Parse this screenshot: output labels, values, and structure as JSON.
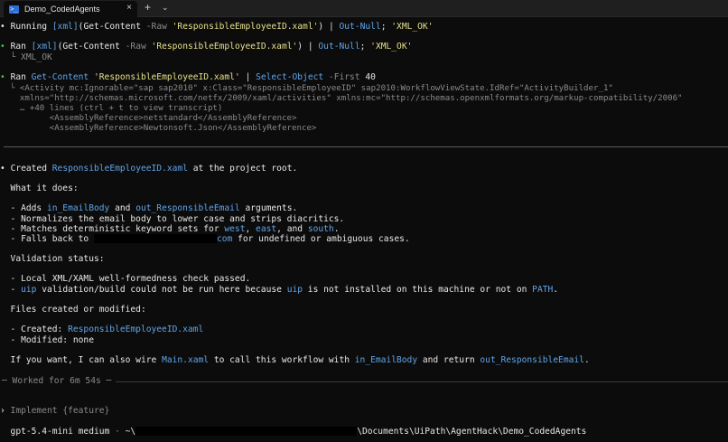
{
  "window": {
    "tab_title": "Demo_CodedAgents",
    "tab_icon": "powershell-icon",
    "close_glyph": "×",
    "new_tab_glyph": "+",
    "dropdown_glyph": "⌄"
  },
  "commands": {
    "running": {
      "bullet": "•",
      "prefix": "Running ",
      "cast": "[xml]",
      "part1": "(Get-Content ",
      "param": "-Raw",
      "sp": " ",
      "file": "'ResponsibleEmployeeID.xaml'",
      "part2": ") | ",
      "outnull": "Out-Null",
      "part3": "; ",
      "ok": "'XML_OK'"
    },
    "ran1": {
      "bullet": "•",
      "prefix": "Ran ",
      "cast": "[xml]",
      "part1": "(Get-Content ",
      "param": "-Raw",
      "sp": " ",
      "file": "'ResponsibleEmployeeID.xaml'",
      "part2": ") | ",
      "outnull": "Out-Null",
      "part3": "; ",
      "ok": "'XML_OK'",
      "output": "  └ XML_OK"
    },
    "ran2": {
      "bullet": "•",
      "prefix": "Ran ",
      "cmd1": "Get-Content",
      "sp": " ",
      "file": "'ResponsibleEmployeeID.xaml'",
      "pipe": " | ",
      "cmd2": "Select-Object",
      "param": " -First ",
      "num": "40",
      "out1": "  └ <Activity mc:Ignorable=\"sap sap2010\" x:Class=\"ResponsibleEmployeeID\" sap2010:WorkflowViewState.IdRef=\"ActivityBuilder_1\"",
      "out2": "    xmlns=\"http://schemas.microsoft.com/netfx/2009/xaml/activities\" xmlns:mc=\"http://schemas.openxmlformats.org/markup-compatibility/2006\"",
      "out3": "    … +40 lines (ctrl + t to view transcript)",
      "out4": "          <AssemblyReference>netstandard</AssemblyReference>",
      "out5": "          <AssemblyReference>Newtonsoft.Json</AssemblyReference>"
    }
  },
  "response": {
    "bullet": "•",
    "created_prefix": "Created ",
    "created_file": "ResponsibleEmployeeID.xaml",
    "created_suffix": " at the project root.",
    "what_heading": "  What it does:",
    "adds_prefix": "  - Adds ",
    "adds_a": "in_EmailBody",
    "adds_mid": " and ",
    "adds_b": "out_ResponsibleEmail",
    "adds_suffix": " arguments.",
    "normalize": "  - Normalizes the email body to lower case and strips diacritics.",
    "matches_prefix": "  - Matches deterministic keyword sets for ",
    "west": "west",
    "comma": ", ",
    "east": "east",
    "and": ", and ",
    "south": "south",
    "period": ".",
    "falls_prefix": "  - Falls back to ",
    "falls_domain": "com",
    "falls_suffix": " for undefined or ambiguous cases.",
    "validation_heading": "  Validation status:",
    "local_check": "  - Local XML/XAML well-formedness check passed.",
    "uip_dash": "  - ",
    "uip1": "uip",
    "uip_mid1": " validation/build could not be run here because ",
    "uip2": "uip",
    "uip_mid2": " is not installed on this machine or not on ",
    "path": "PATH",
    "files_heading": "  Files created or modified:",
    "files_created_prefix": "  - Created: ",
    "files_created": "ResponsibleEmployeeID.xaml",
    "files_modified": "  - Modified: none",
    "offer_prefix": "  If you want, I can also wire ",
    "offer_main": "Main.xaml",
    "offer_mid1": " to call this workflow with ",
    "offer_in": "in_EmailBody",
    "offer_mid2": " and return ",
    "offer_out": "out_ResponsibleEmail",
    "offer_end": "."
  },
  "worked": {
    "text": "─ Worked for 6m 54s ─"
  },
  "prompt": {
    "caret": "›",
    "placeholder": " Implement {feature}"
  },
  "status": {
    "model": "  gpt-5.4-mini medium",
    "sep": " · ",
    "home": "~\\",
    "path": "\\Documents\\UiPath\\AgentHack\\Demo_CodedAgents"
  }
}
